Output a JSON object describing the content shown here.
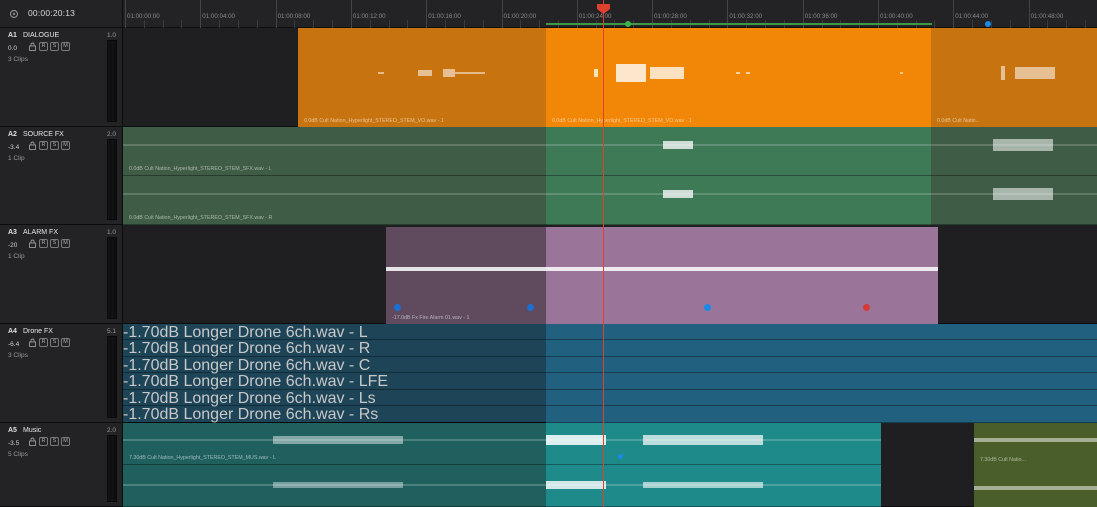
{
  "timeline": {
    "timecode": "00:00:20:13",
    "ruler_labels": [
      "01:00:00:00",
      "01:00:04:00",
      "01:00:08:00",
      "01:00:12:00",
      "01:00:16:00",
      "01:00:20:00",
      "01:00:24:00",
      "01:00:28:00",
      "01:00:32:00",
      "01:00:36:00",
      "01:00:40:00",
      "01:00:44:00",
      "01:00:48:00"
    ]
  },
  "colors": {
    "dialogue": "#c77410",
    "dialogue_active": "#f18607",
    "source_fx": "#3e5c46",
    "source_fx_active": "#3f7a57",
    "alarm_fx": "#5f4a5e",
    "alarm_fx_active": "#9a7599",
    "drone_fx": "#1e4458",
    "drone_fx_active": "#22607f",
    "music": "#1f605f",
    "music_active": "#1f8a8a",
    "music_alt": "#4a5e2a",
    "playhead": "#e0412e"
  },
  "tracks": [
    {
      "id": "A1",
      "name": "DIALOGUE",
      "format": "1.0",
      "volume": "0.0",
      "clips": "3 Clips",
      "clip_labels": [
        "0.0dB   Cult Nation_Hyperlight_STEREO_STEM_VO.wav - 1",
        "0.0dB   Cult Nation_Hyperlight_STEREO_STEM_VO.wav - 1",
        "0.0dB   Cult Natio..."
      ]
    },
    {
      "id": "A2",
      "name": "SOURCE FX",
      "format": "2.0",
      "volume": "-3.4",
      "clips": "1 Clip",
      "clip_labels": [
        "0.0dB   Cult Nation_Hyperlight_STEREO_STEM_SFX.wav - L",
        "0.0dB   Cult Nation_Hyperlight_STEREO_STEM_SFX.wav - R"
      ]
    },
    {
      "id": "A3",
      "name": "ALARM FX",
      "format": "1.0",
      "volume": "-20",
      "clips": "1 Clip",
      "clip_labels": [
        "-17.0dB   Fx   Fire Alarm 01.wav - 1"
      ]
    },
    {
      "id": "A4",
      "name": "Drone FX",
      "format": "5.1",
      "volume": "-6.4",
      "clips": "3 Clips",
      "clip_labels": [
        "-1.70dB   Longer Drone 6ch.wav - L",
        "-1.70dB   Longer Drone 6ch.wav - R",
        "-1.70dB   Longer Drone 6ch.wav - C",
        "-1.70dB   Longer Drone 6ch.wav - LFE",
        "-1.70dB   Longer Drone 6ch.wav - Ls",
        "-1.70dB   Longer Drone 6ch.wav - Rs"
      ]
    },
    {
      "id": "A5",
      "name": "Music",
      "format": "2.0",
      "volume": "-3.5",
      "clips": "5 Clips",
      "clip_labels": [
        "7.30dB   Cult Nation_Hyperlight_STEREO_STEM_MUS.wav - L",
        "7.30dB   Cult Natio..."
      ]
    }
  ],
  "buttons": {
    "r": "R",
    "s": "S",
    "m": "M"
  },
  "icons": {
    "lock": "lock-icon",
    "settings": "gear-icon"
  }
}
